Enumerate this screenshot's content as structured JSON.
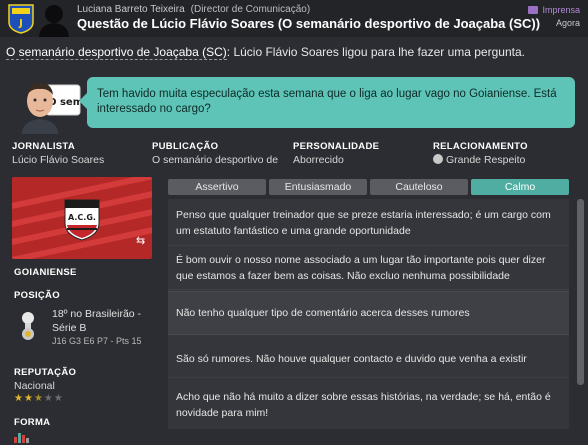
{
  "header": {
    "reporter_name": "Luciana Barreto Teixeira",
    "reporter_role": "(Director de Comunicação)",
    "title": "Questão de Lúcio Flávio Soares (O semanário desportivo de Joaçaba (SC))",
    "press_label": "Imprensa",
    "time_label": "Agora"
  },
  "intro": {
    "publication_link": "O semanário desportivo de Joaçaba (SC)",
    "text": ": Lúcio Flávio Soares ligou para lhe fazer uma pergunta."
  },
  "question": {
    "text": "Tem havido muita especulação esta semana que o liga ao lugar vago no Goianiense. Está interessado no cargo?",
    "face_sign": "O sema"
  },
  "info": {
    "journalist_label": "JORNALISTA",
    "journalist_value": "Lúcio Flávio Soares",
    "publication_label": "PUBLICAÇÃO",
    "publication_value": "O semanário desportivo de Joaçaba (SC)",
    "personality_label": "PERSONALIDADE",
    "personality_value": "Aborrecido",
    "relationship_label": "RELACIONAMENTO",
    "relationship_value": "Grande Respeito"
  },
  "club": {
    "badge_text": "A.C.G.",
    "name": "GOIANIENSE",
    "position_label": "POSIÇÃO",
    "position_line1": "18º no Brasileirão -",
    "position_line2": "Série B",
    "position_stats": "J16 G3 E6 P7 - Pts 15",
    "reputation_label": "REPUTAÇÃO",
    "reputation_value": "Nacional",
    "reputation_stars": 2.5,
    "form_label": "FORMA"
  },
  "tones": [
    {
      "label": "Assertivo",
      "active": false
    },
    {
      "label": "Entusiasmado",
      "active": false
    },
    {
      "label": "Cauteloso",
      "active": false
    },
    {
      "label": "Calmo",
      "active": true
    }
  ],
  "responses": [
    "Penso que qualquer treinador que se preze estaria interessado; é um cargo com um estatuto fantástico e uma grande oportunidade",
    "É bom ouvir o nosso nome associado a um lugar tão importante pois quer dizer que estamos a fazer bem as coisas. Não excluo nenhuma possibilidade",
    "Não tenho qualquer tipo de comentário acerca desses rumores",
    "São só rumores. Não houve qualquer contacto e duvido que venha a existir",
    "Acho que não há muito a dizer sobre essas histórias, na verdade; se há, então é novidade para mim!"
  ],
  "colors": {
    "accent": "#4faea1",
    "bubble": "#5ec4b7",
    "club_red": "#b52828",
    "press": "#b38bd6"
  }
}
